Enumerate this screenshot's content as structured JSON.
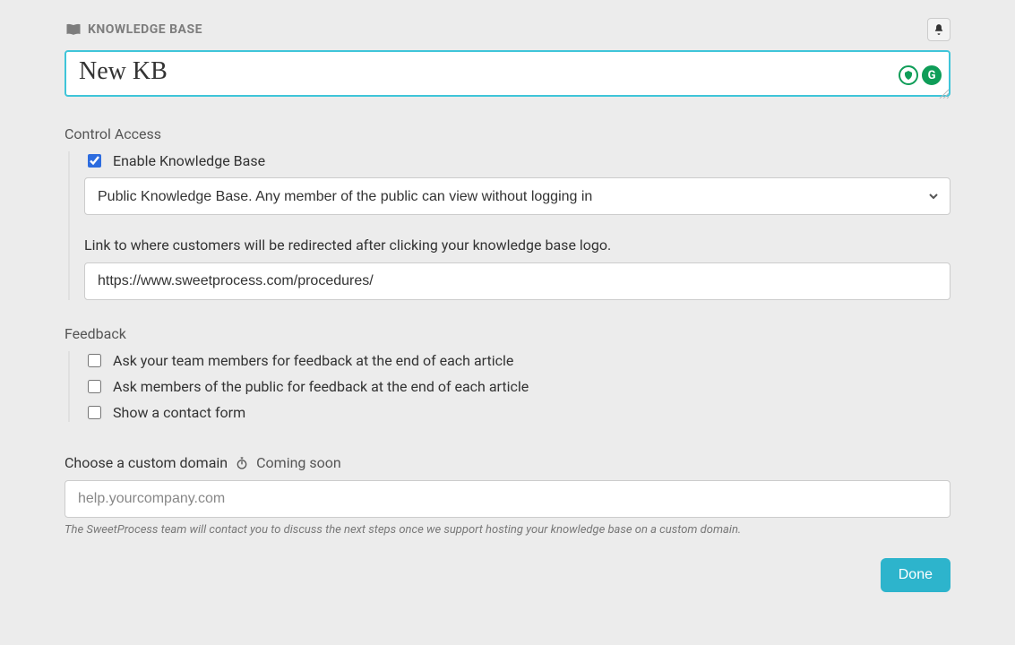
{
  "header": {
    "title": "KNOWLEDGE BASE",
    "book_icon": "book-icon",
    "bell_icon": "bell-icon"
  },
  "title_input": {
    "value": "New KB",
    "grammarly_shield": "G"
  },
  "control_access": {
    "section_title": "Control Access",
    "enable_label": "Enable Knowledge Base",
    "enable_checked": true,
    "visibility_selected": "Public Knowledge Base. Any member of the public can view without logging in",
    "redirect_label": "Link to where customers will be redirected after clicking your knowledge base logo.",
    "redirect_value": "https://www.sweetprocess.com/procedures/"
  },
  "feedback": {
    "section_title": "Feedback",
    "items": [
      {
        "label": "Ask your team members for feedback at the end of each article",
        "checked": false
      },
      {
        "label": "Ask members of the public for feedback at the end of each article",
        "checked": false
      },
      {
        "label": "Show a contact form",
        "checked": false
      }
    ]
  },
  "custom_domain": {
    "heading": "Choose a custom domain",
    "coming_soon": "Coming soon",
    "placeholder": "help.yourcompany.com",
    "value": "",
    "note": "The SweetProcess team will contact you to discuss the next steps once we support hosting your knowledge base on a custom domain."
  },
  "footer": {
    "done_label": "Done"
  }
}
